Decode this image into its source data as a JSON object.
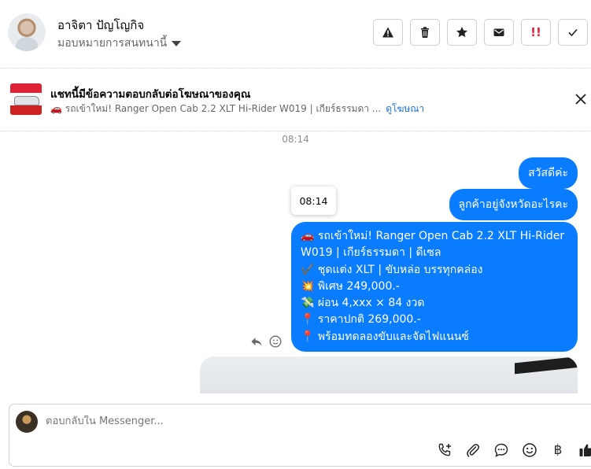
{
  "header": {
    "contact_name": "อาจิตา ปัญโญกิจ",
    "assign_label": "มอบหมายการสนทนานี้",
    "actions": [
      {
        "name": "report-icon"
      },
      {
        "name": "trash-icon"
      },
      {
        "name": "star-icon"
      },
      {
        "name": "mail-icon"
      },
      {
        "name": "spam-icon",
        "label": "!!"
      },
      {
        "name": "check-icon"
      }
    ]
  },
  "ad_banner": {
    "title": "แชทนี้มีข้อความตอบกลับต่อโฆษณาของคุณ",
    "ad_text": "🚗 รถเข้าใหม่! Ranger Open Cab 2.2 XLT Hi-Rider W019 | เกียร์ธรรมดา ...",
    "link_label": "ดูโฆษณา"
  },
  "chat": {
    "timestamp": "08:14",
    "tooltip_time": "08:14",
    "messages": [
      {
        "text": "สวัสดีค่ะ"
      },
      {
        "text": "ลูกค้าอยู่จังหวัดอะไรคะ"
      }
    ],
    "ad_message_lines": [
      "🚗 รถเข้าใหม่! Ranger Open Cab 2.2 XLT Hi-Rider W019 | เกียร์ธรรมดา | ดีเซล",
      "✔️ ชุดแต่ง XLT | ขับหล่อ บรรทุกคล่อง",
      "💥 พิเศษ 249,000.-",
      "💸 ผ่อน 4,xxx × 84 งวด",
      "📍 ราคาปกติ 269,000.-",
      "📍 พร้อมทดลองขับและจัดไฟแนนซ์"
    ]
  },
  "composer": {
    "placeholder": "ตอบกลับใน Messenger...",
    "baht_symbol": "฿"
  },
  "colors": {
    "bubble": "#0a7cff",
    "link": "#1b74e4",
    "spam": "#e41e3f"
  }
}
